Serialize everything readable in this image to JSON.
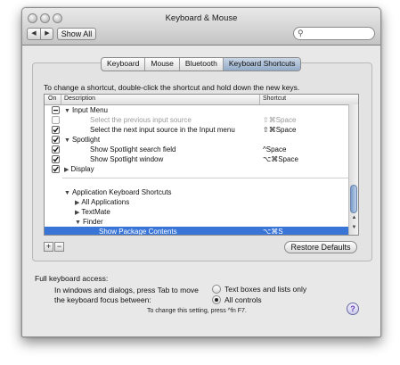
{
  "window": {
    "title": "Keyboard & Mouse"
  },
  "toolbar": {
    "back_icon": "◀",
    "forward_icon": "▶",
    "show_all_label": "Show All",
    "search_value": "",
    "search_icon": "search-icon"
  },
  "tabs": [
    {
      "label": "Keyboard",
      "active": false
    },
    {
      "label": "Mouse",
      "active": false
    },
    {
      "label": "Bluetooth",
      "active": false
    },
    {
      "label": "Keyboard Shortcuts",
      "active": true
    }
  ],
  "instructions": "To change a shortcut, double-click the shortcut and hold down the new keys.",
  "table": {
    "columns": {
      "on": "On",
      "description": "Description",
      "shortcut": "Shortcut"
    },
    "rows": [
      {
        "check": "mixed",
        "triangle": "▼",
        "label": "Input Menu",
        "shortcut": "",
        "indent": 0,
        "gray": false,
        "selected": false
      },
      {
        "check": "off",
        "triangle": "",
        "label": "Select the previous input source",
        "shortcut": "⇧⌘Space",
        "indent": 2,
        "gray": true,
        "selected": false
      },
      {
        "check": "on",
        "triangle": "",
        "label": "Select the next input source in the Input menu",
        "shortcut": "⇧⌘Space",
        "indent": 2,
        "gray": false,
        "selected": false
      },
      {
        "check": "on",
        "triangle": "▼",
        "label": "Spotlight",
        "shortcut": "",
        "indent": 0,
        "gray": false,
        "selected": false
      },
      {
        "check": "on",
        "triangle": "",
        "label": "Show Spotlight search field",
        "shortcut": "^Space",
        "indent": 2,
        "gray": false,
        "selected": false
      },
      {
        "check": "on",
        "triangle": "",
        "label": "Show Spotlight window",
        "shortcut": "⌥⌘Space",
        "indent": 2,
        "gray": false,
        "selected": false
      },
      {
        "check": "on",
        "triangle": "▶",
        "label": "Display",
        "shortcut": "",
        "indent": 0,
        "gray": false,
        "selected": false
      },
      {
        "check": "",
        "triangle": "▼",
        "label": "Application Keyboard Shortcuts",
        "shortcut": "",
        "indent": 0,
        "gray": false,
        "selected": false
      },
      {
        "check": "",
        "triangle": "▶",
        "label": "All Applications",
        "shortcut": "",
        "indent": 1,
        "gray": false,
        "selected": false
      },
      {
        "check": "",
        "triangle": "▶",
        "label": "TextMate",
        "shortcut": "",
        "indent": 1,
        "gray": false,
        "selected": false
      },
      {
        "check": "",
        "triangle": "▼",
        "label": "Finder",
        "shortcut": "",
        "indent": 1,
        "gray": false,
        "selected": false
      },
      {
        "check": "",
        "triangle": "",
        "label": "Show Package Contents",
        "shortcut": "⌥⌘S",
        "indent": 3,
        "gray": false,
        "selected": true
      }
    ]
  },
  "buttons": {
    "add": "+",
    "remove": "−",
    "restore_defaults": "Restore Defaults"
  },
  "keyboard_access": {
    "heading": "Full keyboard access:",
    "line1": "In windows and dialogs, press Tab to move",
    "line2": "the keyboard focus between:",
    "options": [
      {
        "label": "Text boxes and lists only",
        "selected": false
      },
      {
        "label": "All controls",
        "selected": true
      }
    ],
    "hint": "To change this setting, press ^fn F7."
  },
  "help": "?"
}
